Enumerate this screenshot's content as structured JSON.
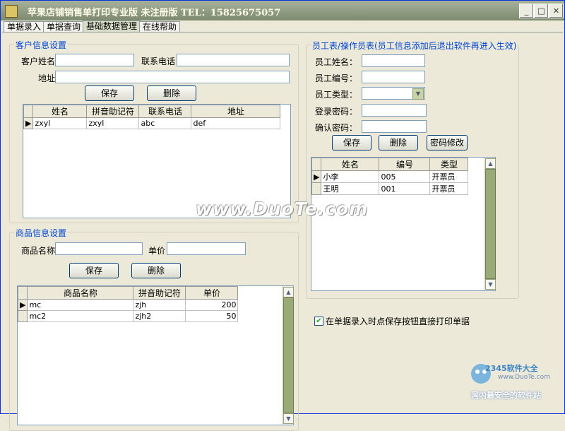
{
  "window": {
    "title": "苹果店铺销售单打印专业版 未注册版    TEL：15825675057"
  },
  "tabs": [
    "单据录入",
    "单据查询",
    "基础数据管理",
    "在线帮助"
  ],
  "customer": {
    "legend": "客户信息设置",
    "name_label": "客户姓名",
    "phone_label": "联系电话",
    "address_label": "地址",
    "save": "保存",
    "delete": "删除",
    "columns": [
      "姓名",
      "拼音助记符",
      "联系电话",
      "地址"
    ],
    "rows": [
      [
        "zxyl",
        "zxyl",
        "abc",
        "def"
      ]
    ]
  },
  "product": {
    "legend": "商品信息设置",
    "name_label": "商品名称",
    "price_label": "单价",
    "save": "保存",
    "delete": "删除",
    "columns": [
      "商品名称",
      "拼音助记符",
      "单价"
    ],
    "rows": [
      [
        "mc",
        "zjh",
        "200"
      ],
      [
        "mc2",
        "zjh2",
        "50"
      ]
    ]
  },
  "staff": {
    "legend": "员工表/操作员表(员工信息添加后退出软件再进入生效)",
    "name_label": "员工姓名：",
    "id_label": "员工编号：",
    "type_label": "员工类型：",
    "password_label": "登录密码：",
    "confirm_label": "确认密码：",
    "save": "保存",
    "delete": "删除",
    "change_password": "密码修改",
    "columns": [
      "姓名",
      "编号",
      "类型"
    ],
    "rows": [
      [
        "小李",
        "005",
        "开票员"
      ],
      [
        "王明",
        "001",
        "开票员"
      ]
    ]
  },
  "print_option": {
    "label": "在单据录入时点保存按钮直接打印单据",
    "checked": true
  },
  "watermark": "www.DuoTe.com",
  "logo": {
    "brand": "2345软件大全",
    "url": "www.DuoTe.com",
    "tagline": "国内最安全的软件站"
  }
}
